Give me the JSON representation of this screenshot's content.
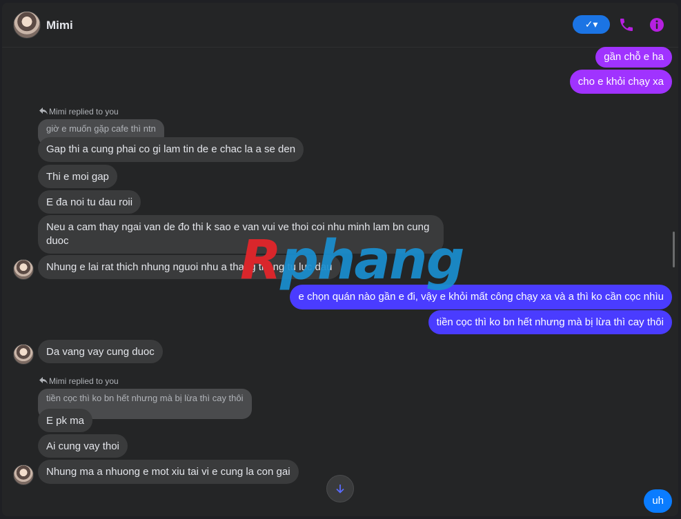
{
  "header": {
    "contact_name": "Mimi",
    "check_button_label": "✓▾"
  },
  "messages": {
    "out1": "gần chỗ e ha",
    "out2": "cho e khỏi chạy xa",
    "reply_label": "Mimi replied to you",
    "quote1": "giờ e muốn gặp cafe thì ntn",
    "in1": "Gap thi a cung phai co gi lam tin de e chac la a se den",
    "in2": "Thi e moi gap",
    "in3": "E đa noi tu dau roii",
    "in4a": "Neu a cam thay ngai van de đo thi k sao e van vui ve thoi coi nhu minh lam bn cung",
    "in4b": "duoc",
    "in5": "Nhung e lai rat thich nhung nguoi nhu a thang thang tu luc dau",
    "out3": "e chọn quán nào gần e đi, vậy e khỏi mất công chạy xa và a thì ko cần cọc nhìu",
    "out4": "tiền cọc thì ko bn hết nhưng mà bị lừa thì cay thôi",
    "in6": "Da vang vay cung duoc",
    "quote2": "tiền cọc thì ko bn hết nhưng mà bị lừa thì cay thôi",
    "in7": "E pk ma",
    "in8": "Ai cung vay thoi",
    "in9": "Nhung ma a nhuong e mot xiu tai vi e cung la con gai",
    "out5": "uh"
  },
  "watermark": {
    "first_letter": "R",
    "rest": "phang"
  },
  "icons": [
    "reply-arrow-icon",
    "phone-icon",
    "info-icon",
    "arrow-down-icon"
  ],
  "colors": {
    "accent_blue": "#1b74e4",
    "purple": "#a033ff",
    "indigo": "#4a3cff",
    "icon_purple": "#b620e0"
  }
}
